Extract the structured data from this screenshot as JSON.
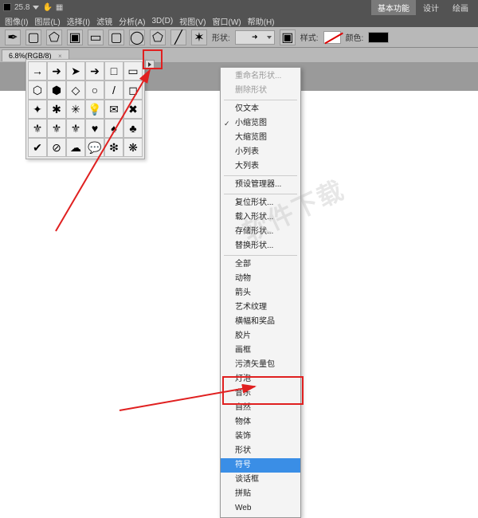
{
  "topbar": {
    "zoom": "25.8",
    "tabs": {
      "basic": "基本功能",
      "design": "设计",
      "paint": "绘画"
    }
  },
  "menu": {
    "image": "图像(I)",
    "layer": "图层(L)",
    "select": "选择(I)",
    "filter": "滤镜",
    "analysis": "分析(A)",
    "threeD": "3D(D)",
    "view": "视图(V)",
    "window": "窗口(W)",
    "help": "帮助(H)"
  },
  "options": {
    "shape_label": "形状:",
    "style_label": "样式:",
    "color_label": "颜色:"
  },
  "docTab": {
    "label": "6.8%(RGB/8)",
    "close": "×"
  },
  "shapesPopout": {
    "cells": [
      "→",
      "➜",
      "➤",
      "➔",
      "□",
      "▭",
      "⬡",
      "⬢",
      "◇",
      "○",
      "/",
      "◻",
      "✦",
      "✱",
      "✳",
      "💡",
      "✉",
      "✖",
      "⚜",
      "⚜",
      "⚜",
      "♥",
      "♠",
      "♣",
      "✔",
      "⊘",
      "☁",
      "💬",
      "❇",
      "❋"
    ]
  },
  "contextMenu": {
    "rename": "重命名形状...",
    "deleteShape": "删除形状",
    "textOnly": "仅文本",
    "smallThumb": "小缩览图",
    "largeThumb": "大缩览图",
    "smallList": "小列表",
    "largeList": "大列表",
    "presetMgr": "预设管理器...",
    "resetShapes": "复位形状...",
    "loadShapes": "载入形状...",
    "saveShapes": "存储形状...",
    "replaceShapes": "替换形状...",
    "all": "全部",
    "animals": "动物",
    "arrows": "箭头",
    "artTextures": "艺术纹理",
    "banners": "横幅和奖品",
    "film": "胶片",
    "frames": "画框",
    "grimeVector": "污渍矢量包",
    "bulbs": "灯泡",
    "music": "音乐",
    "nature": "自然",
    "objects": "物体",
    "ornaments": "装饰",
    "shapes": "形状",
    "symbols": "符号",
    "talkBubbles": "谈话框",
    "tiles": "拼贴",
    "web": "Web"
  },
  "watermark": "软件下载"
}
